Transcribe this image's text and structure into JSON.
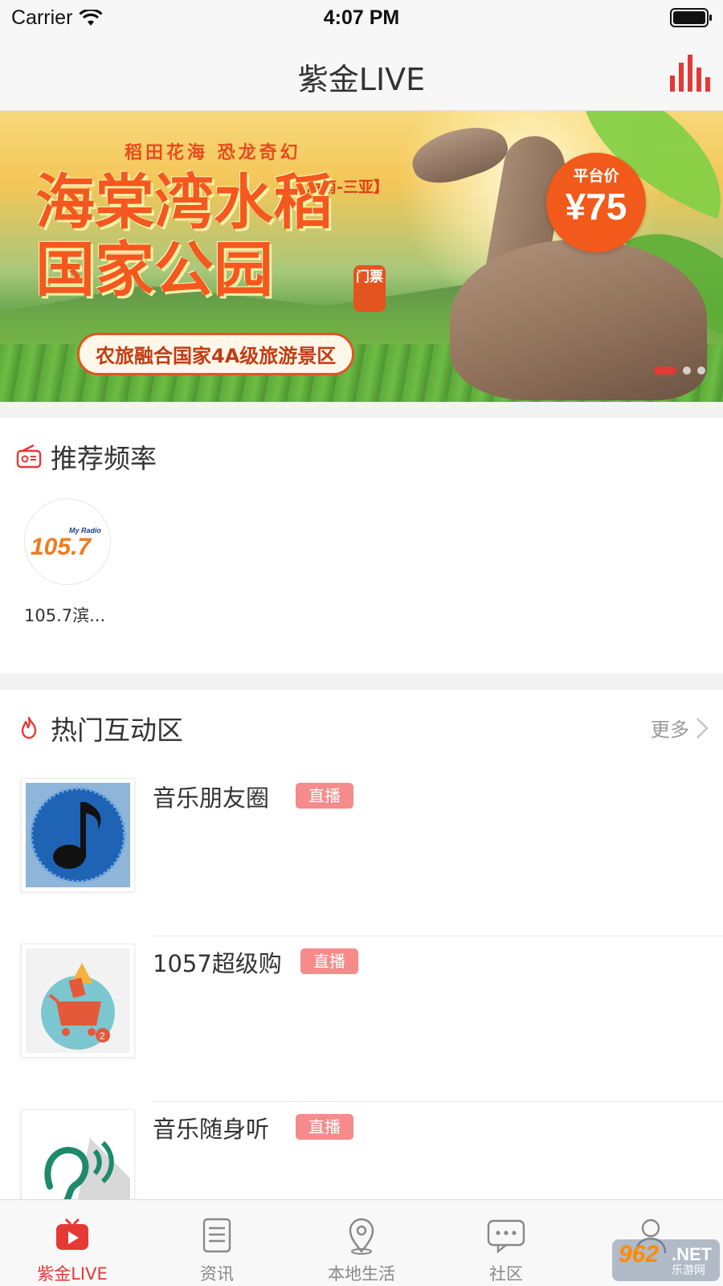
{
  "status_bar": {
    "carrier": "Carrier",
    "time": "4:07 PM"
  },
  "nav": {
    "title": "紫金LIVE",
    "right_icon": "audio-bars-icon"
  },
  "banner": {
    "subtitle": "稻田花海  恐龙奇幻",
    "region": "【海南-三亚】",
    "title_line1": "海棠湾水稻",
    "title_line2": "国家公园",
    "ticket_tag": "门票",
    "tagline": "农旅融合国家4A级旅游景区",
    "price_label": "平台价",
    "price_value": "¥75",
    "dot_count": 3,
    "active_dot": 0
  },
  "recommended": {
    "title": "推荐频率",
    "icon": "radio-icon",
    "items": [
      {
        "name": "105.7滨...",
        "logo_text": "105.7",
        "logo_sub": "My Radio"
      }
    ]
  },
  "hot": {
    "title": "热门互动区",
    "icon": "flame-icon",
    "more_label": "更多",
    "items": [
      {
        "title": "音乐朋友圈",
        "badge": "直播",
        "thumb": "music-note-thumb"
      },
      {
        "title": "1057超级购",
        "badge": "直播",
        "thumb": "shopping-cart-thumb"
      },
      {
        "title": "音乐随身听",
        "badge": "直播",
        "thumb": "ear-listen-thumb"
      }
    ]
  },
  "tabs": [
    {
      "label": "紫金LIVE",
      "icon": "tv-icon",
      "active": true
    },
    {
      "label": "资讯",
      "icon": "news-list-icon",
      "active": false
    },
    {
      "label": "本地生活",
      "icon": "location-pin-icon",
      "active": false
    },
    {
      "label": "社区",
      "icon": "chat-bubble-icon",
      "active": false
    },
    {
      "label": "",
      "icon": "user-icon",
      "active": false
    }
  ],
  "watermark": {
    "number": "962",
    "suffix": ".NET",
    "sub": "乐游网"
  },
  "colors": {
    "accent": "#e53935",
    "badge": "#f58b8b",
    "gap": "#f3f3f3"
  }
}
